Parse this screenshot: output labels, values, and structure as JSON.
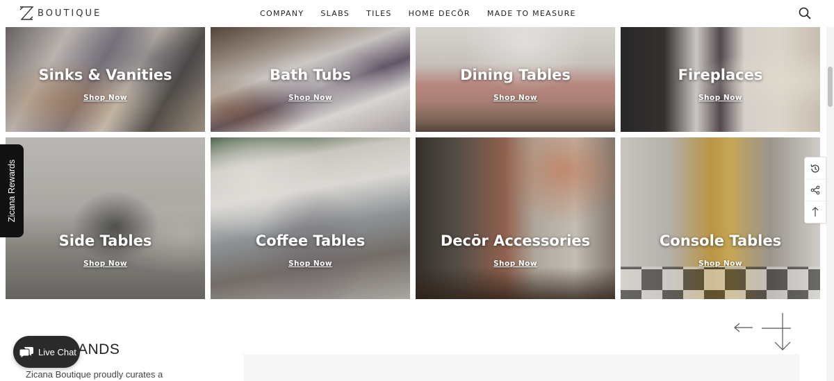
{
  "brand": {
    "name": "BOUTIQUE",
    "logo_icon": "z-monogram-icon"
  },
  "nav": [
    "COMPANY",
    "SLABS",
    "TILES",
    "HOME DECŌR",
    "MADE TO MEASURE"
  ],
  "search_icon": "search-icon",
  "tiles": [
    {
      "title": "Sinks & Vanities",
      "link": "Shop Now"
    },
    {
      "title": "Bath Tubs",
      "link": "Shop Now"
    },
    {
      "title": "Dining Tables",
      "link": "Shop Now"
    },
    {
      "title": "Fireplaces",
      "link": "Shop Now"
    },
    {
      "title": "Side Tables",
      "link": "Shop Now"
    },
    {
      "title": "Coffee Tables",
      "link": "Shop Now"
    },
    {
      "title": "Decōr Accessories",
      "link": "Shop Now"
    },
    {
      "title": "Console Tables",
      "link": "Shop Now"
    }
  ],
  "rewards": {
    "label": "Zicana Rewards"
  },
  "side_tools": [
    "history-icon",
    "share-icon",
    "scroll-top-icon"
  ],
  "brands": {
    "heading": "ANDS",
    "description": "Zicana Boutique proudly curates a"
  },
  "live_chat": {
    "label": "Live Chat",
    "icon": "chat-bubble-icon"
  },
  "colors": {
    "header_bg": "#ffffff",
    "chat_bg": "#2a2a2a",
    "rewards_bg": "#111111",
    "text": "#222222"
  }
}
